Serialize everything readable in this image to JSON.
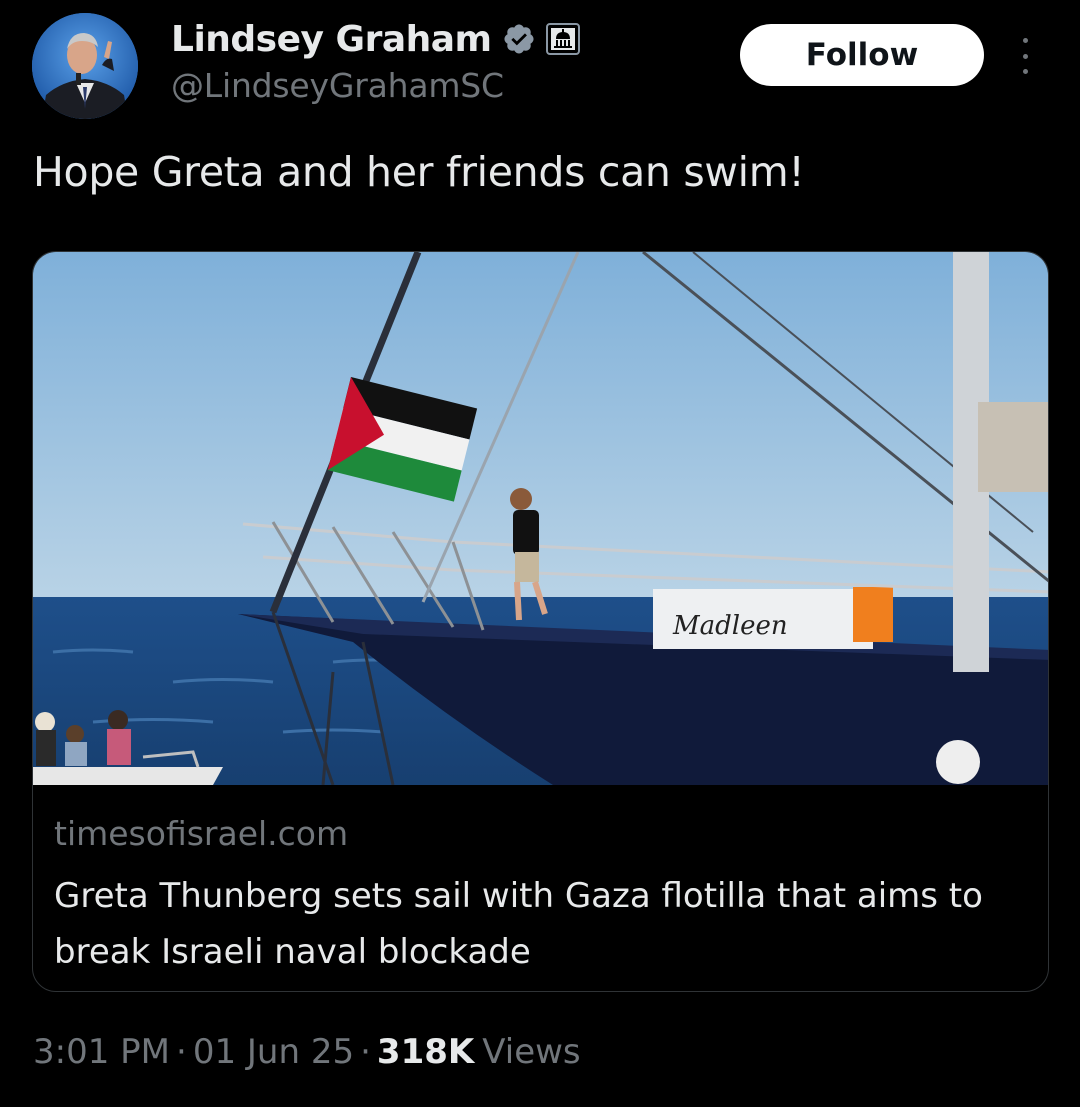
{
  "author": {
    "display_name": "Lindsey Graham",
    "handle": "@LindseyGrahamSC",
    "verified_icon": "verified-badge-icon",
    "affiliation_icon": "government-building-icon"
  },
  "actions": {
    "follow_label": "Follow",
    "more_icon": "more-vertical-icon"
  },
  "tweet": {
    "text": "Hope Greta and her friends can swim!"
  },
  "link_card": {
    "domain": "timesofisrael.com",
    "title": "Greta Thunberg sets sail with Gaza flotilla that aims to break Israeli naval blockade",
    "image_boat_name": "Madleen"
  },
  "meta": {
    "time": "3:01 PM",
    "date": "01 Jun 25",
    "separator": "·",
    "views_count": "318K",
    "views_label": "Views"
  },
  "colors": {
    "background": "#000000",
    "primary_text": "#e7e9ea",
    "secondary_text": "#71767b",
    "verified_blue": "#1d9bf0",
    "follow_bg": "#ffffff"
  }
}
